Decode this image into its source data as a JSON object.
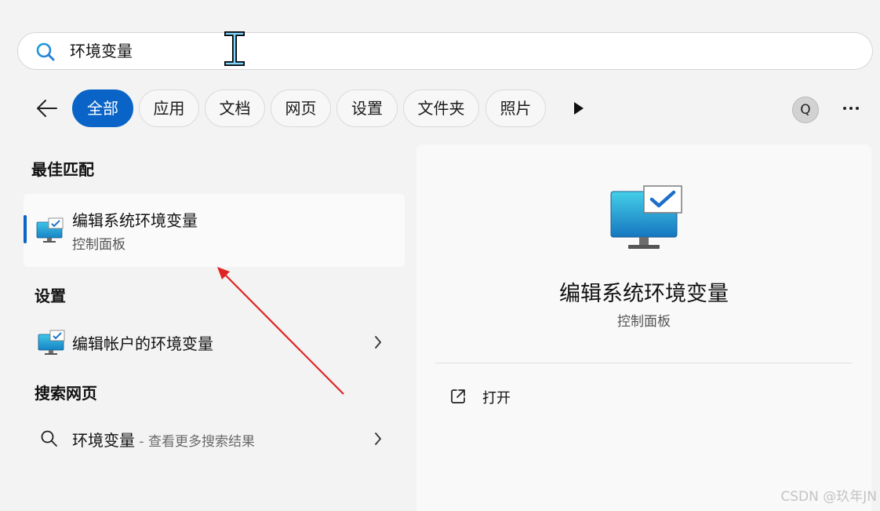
{
  "search": {
    "query": "环境变量"
  },
  "filters": [
    "全部",
    "应用",
    "文档",
    "网页",
    "设置",
    "文件夹",
    "照片"
  ],
  "avatar_letter": "Q",
  "best_match": {
    "section": "最佳匹配",
    "title": "编辑系统环境变量",
    "subtitle": "控制面板"
  },
  "settings": {
    "section": "设置",
    "item": "编辑帐户的环境变量"
  },
  "web": {
    "section": "搜索网页",
    "item": "环境变量",
    "suffix": " - 查看更多搜索结果"
  },
  "details": {
    "title": "编辑系统环境变量",
    "subtitle": "控制面板",
    "action_open": "打开"
  },
  "watermark": "CSDN @玖年JN",
  "colors": {
    "accent": "#0a64c8",
    "annotation_arrow": "#e02424"
  }
}
